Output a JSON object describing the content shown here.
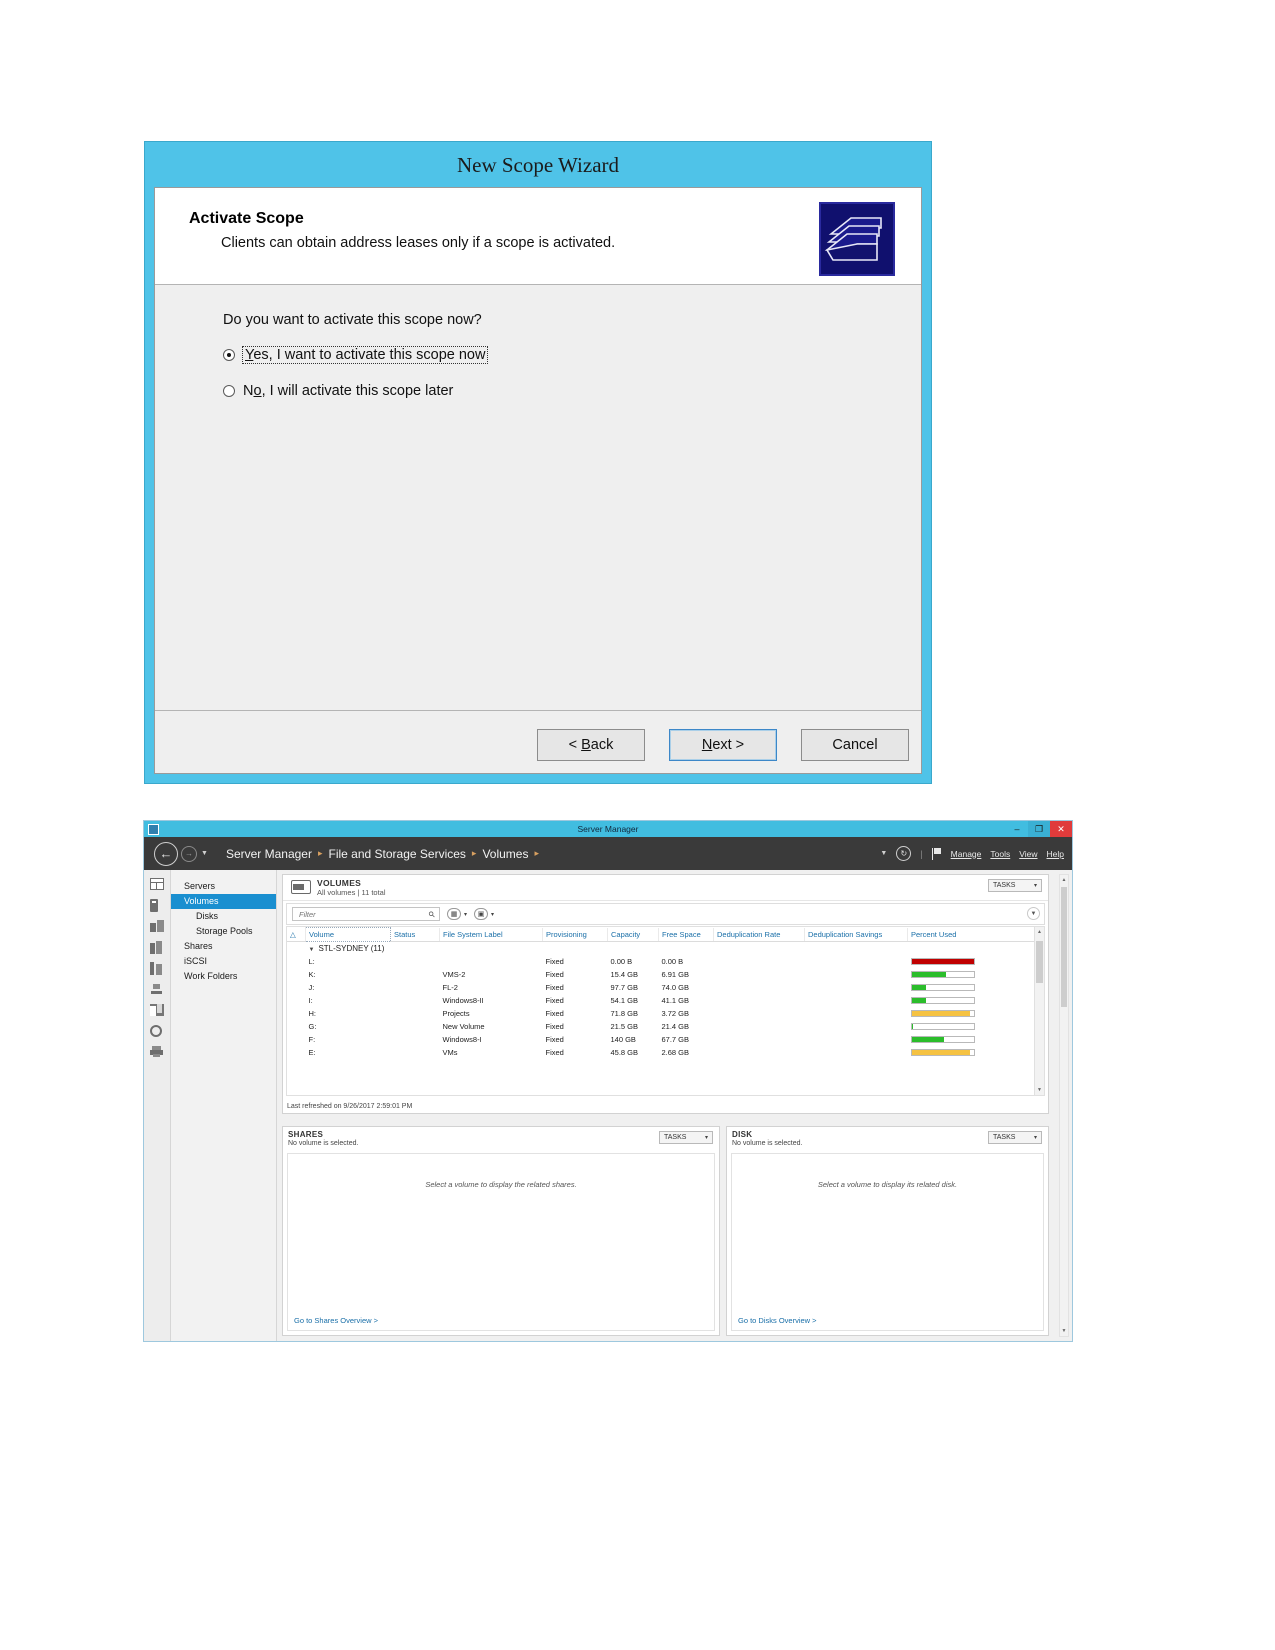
{
  "wizard": {
    "title": "New Scope Wizard",
    "heading": "Activate Scope",
    "subheading": "Clients can obtain address leases only if a scope is activated.",
    "question": "Do you want to activate this scope now?",
    "options": [
      {
        "label_pre": "",
        "label_accel": "Y",
        "label_post": "es, I want to activate this scope now",
        "checked": true,
        "focused": true
      },
      {
        "label_pre": "N",
        "label_accel": "o",
        "label_post": ", I will activate this scope later",
        "checked": false,
        "focused": false
      }
    ],
    "buttons": [
      {
        "pre": "< ",
        "accel": "B",
        "post": "ack",
        "focused": false
      },
      {
        "pre": "",
        "accel": "N",
        "post": "ext >",
        "focused": true
      },
      {
        "pre": "Cancel",
        "accel": "",
        "post": "",
        "focused": false
      }
    ]
  },
  "server_manager": {
    "window_title": "Server Manager",
    "window_controls": [
      "–",
      "❐",
      "✕"
    ],
    "breadcrumb": [
      "Server Manager",
      "File and Storage Services",
      "Volumes"
    ],
    "breadcrumb_separator": "▸",
    "nav_menus": [
      "Manage",
      "Tools",
      "View",
      "Help"
    ],
    "sidebar": [
      {
        "label": "Servers",
        "indent": false,
        "selected": false
      },
      {
        "label": "Volumes",
        "indent": false,
        "selected": true
      },
      {
        "label": "Disks",
        "indent": true,
        "selected": false
      },
      {
        "label": "Storage Pools",
        "indent": true,
        "selected": false
      },
      {
        "label": "Shares",
        "indent": false,
        "selected": false
      },
      {
        "label": "iSCSI",
        "indent": false,
        "selected": false
      },
      {
        "label": "Work Folders",
        "indent": false,
        "selected": false
      }
    ],
    "volumes_panel": {
      "title": "VOLUMES",
      "subtitle": "All volumes | 11 total",
      "tasks_label": "TASKS",
      "caret": "▾",
      "filter_placeholder": "Filter",
      "filter_value": "",
      "columns": [
        "Volume",
        "Status",
        "File System Label",
        "Provisioning",
        "Capacity",
        "Free Space",
        "Deduplication Rate",
        "Deduplication Savings",
        "Percent Used"
      ],
      "group": "STL-SYDNEY (11)",
      "rows": [
        {
          "volume": "L:",
          "status": "",
          "label": "",
          "provisioning": "Fixed",
          "capacity": "0.00 B",
          "free": "0.00 B",
          "dedup_rate": "",
          "dedup_savings": "",
          "percent": 100,
          "bar_color": "#c00000"
        },
        {
          "volume": "K:",
          "status": "",
          "label": "VMS-2",
          "provisioning": "Fixed",
          "capacity": "15.4 GB",
          "free": "6.91 GB",
          "dedup_rate": "",
          "dedup_savings": "",
          "percent": 55,
          "bar_color": "#2bbd2b"
        },
        {
          "volume": "J:",
          "status": "",
          "label": "FL-2",
          "provisioning": "Fixed",
          "capacity": "97.7 GB",
          "free": "74.0 GB",
          "dedup_rate": "",
          "dedup_savings": "",
          "percent": 24,
          "bar_color": "#2bbd2b"
        },
        {
          "volume": "I:",
          "status": "",
          "label": "Windows8-II",
          "provisioning": "Fixed",
          "capacity": "54.1 GB",
          "free": "41.1 GB",
          "dedup_rate": "",
          "dedup_savings": "",
          "percent": 24,
          "bar_color": "#2bbd2b"
        },
        {
          "volume": "H:",
          "status": "",
          "label": "Projects",
          "provisioning": "Fixed",
          "capacity": "71.8 GB",
          "free": "3.72 GB",
          "dedup_rate": "",
          "dedup_savings": "",
          "percent": 95,
          "bar_color": "#f5c242"
        },
        {
          "volume": "G:",
          "status": "",
          "label": "New Volume",
          "provisioning": "Fixed",
          "capacity": "21.5 GB",
          "free": "21.4 GB",
          "dedup_rate": "",
          "dedup_savings": "",
          "percent": 2,
          "bar_color": "#2bbd2b"
        },
        {
          "volume": "F:",
          "status": "",
          "label": "Windows8-I",
          "provisioning": "Fixed",
          "capacity": "140 GB",
          "free": "67.7 GB",
          "dedup_rate": "",
          "dedup_savings": "",
          "percent": 52,
          "bar_color": "#2bbd2b"
        },
        {
          "volume": "E:",
          "status": "",
          "label": "VMs",
          "provisioning": "Fixed",
          "capacity": "45.8 GB",
          "free": "2.68 GB",
          "dedup_rate": "",
          "dedup_savings": "",
          "percent": 94,
          "bar_color": "#f5c242"
        }
      ],
      "last_refreshed": "Last refreshed on 9/26/2017 2:59:01 PM"
    },
    "shares_panel": {
      "title": "SHARES",
      "subtitle": "No volume is selected.",
      "tasks_label": "TASKS",
      "empty_text": "Select a volume to display the related shares.",
      "link": "Go to Shares Overview >"
    },
    "disk_panel": {
      "title": "DISK",
      "subtitle": "No volume is selected.",
      "tasks_label": "TASKS",
      "empty_text": "Select a volume to display its related disk.",
      "link": "Go to Disks Overview >"
    }
  }
}
